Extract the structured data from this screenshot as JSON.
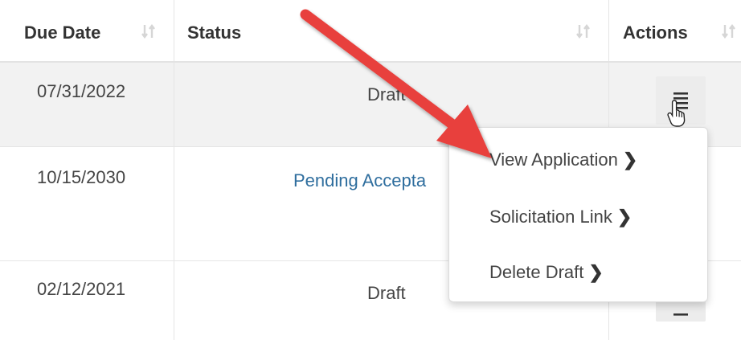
{
  "table": {
    "headers": {
      "due_date": "Due Date",
      "status": "Status",
      "actions": "Actions"
    },
    "rows": [
      {
        "due_date": "07/31/2022",
        "status": "Draft",
        "status_is_link": false
      },
      {
        "due_date": "10/15/2030",
        "status": "Pending Accepta",
        "status_is_link": true
      },
      {
        "due_date": "02/12/2021",
        "status": "Draft",
        "status_is_link": false
      }
    ]
  },
  "actions_menu": {
    "items": [
      {
        "label": "View Application"
      },
      {
        "label": "Solicitation Link"
      },
      {
        "label": "Delete Draft"
      }
    ],
    "chevron": "❯"
  },
  "annotation": {
    "arrow_color": "#e8403d"
  },
  "colors": {
    "link": "#2f6e9e",
    "row_highlight": "#f2f2f2"
  }
}
